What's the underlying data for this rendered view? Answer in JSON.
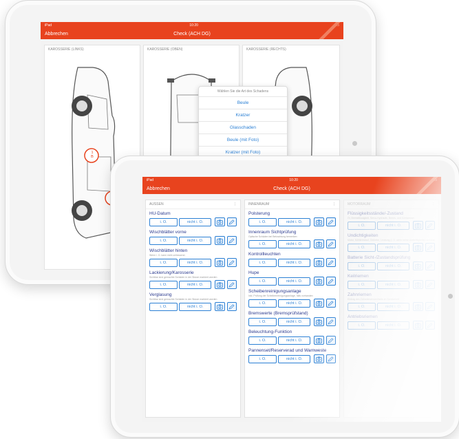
{
  "back_tablet": {
    "status_left": "iPad",
    "status_time": "10:20",
    "nav_left": "Abbrechen",
    "nav_title": "Check (ACH DG)",
    "panels": [
      "KAROSSERIE (LINKS)",
      "KAROSSERIE (OBEN)",
      "KAROSSERIE (RECHTS)"
    ],
    "markers": [
      {
        "label": "1\nB"
      },
      {
        "label": "2\nG"
      }
    ],
    "popup": {
      "header": "Wählen Sie die Art des Schadens",
      "options": [
        "Beule",
        "Kratzer",
        "Glasschaden",
        "Beule (mit Foto)",
        "Kratzer (mit Foto)"
      ]
    }
  },
  "front_tablet": {
    "status_left": "iPad",
    "status_time": "10:20",
    "nav_left": "Abbrechen",
    "nav_title": "Check (ACH DG)",
    "ok_label": "i. O.",
    "not_ok_label": "nicht i. O.",
    "menu_icon": "more-vertical-icon",
    "columns": [
      {
        "header": "AUSSEN",
        "items": [
          {
            "title": "HU-Datum",
            "note": ""
          },
          {
            "title": "Wischblätter vorne",
            "note": ""
          },
          {
            "title": "Wischblätter hinten",
            "note": "Wenn i. O. kann nicht umfassend."
          },
          {
            "title": "Lackierung/Karosserie",
            "note": "Sichtbar sind gemachte Schäden in der Skizze markiert worden"
          },
          {
            "title": "Verglasung",
            "note": "Sichtbar sind gemachte Schäden in der Skizze markiert worden"
          }
        ]
      },
      {
        "header": "INNENRAUM",
        "items": [
          {
            "title": "Polsterung",
            "note": ""
          },
          {
            "title": "Innenraum Sichtprüfung",
            "note": "Optische Schäden bei Betrachtung bemerken"
          },
          {
            "title": "Kontrollleuchten",
            "note": ""
          },
          {
            "title": "Hupe",
            "note": ""
          },
          {
            "title": "Scheibenreinigungsanlage",
            "note": "Inkl. Prüfung der Scheibenreinigungsanlage, falls vorhanden"
          },
          {
            "title": "Bremswerte (Bremsprüfstand)",
            "note": ""
          },
          {
            "title": "Beleuchtung-Funktion",
            "note": ""
          },
          {
            "title": "Pannenset/Reserverad und Warnweste",
            "note": ""
          }
        ]
      },
      {
        "header": "MOTORRAUM",
        "items": [
          {
            "title": "Flüssigkeitsstände/-Zustand",
            "note": "Öl, Bremsflüssigkeit, Servo-Hydraulik, Brems- und Kühlwasser"
          },
          {
            "title": "Undichtigkeiten",
            "note": "Motor, Kühlkreislauf, Getriebe, Lenkung (i. O. wenn keine Undichtigkeiten sichtbar)"
          },
          {
            "title": "Batterie Sicht-/Zustandsprüfung",
            "note": ""
          },
          {
            "title": "Keilriemen",
            "note": ""
          },
          {
            "title": "Zahnriemen",
            "note": "Eintrag des Zahnriemenwechsels im Serviceheft"
          },
          {
            "title": "Antriebsriemen",
            "note": ""
          }
        ]
      }
    ]
  }
}
